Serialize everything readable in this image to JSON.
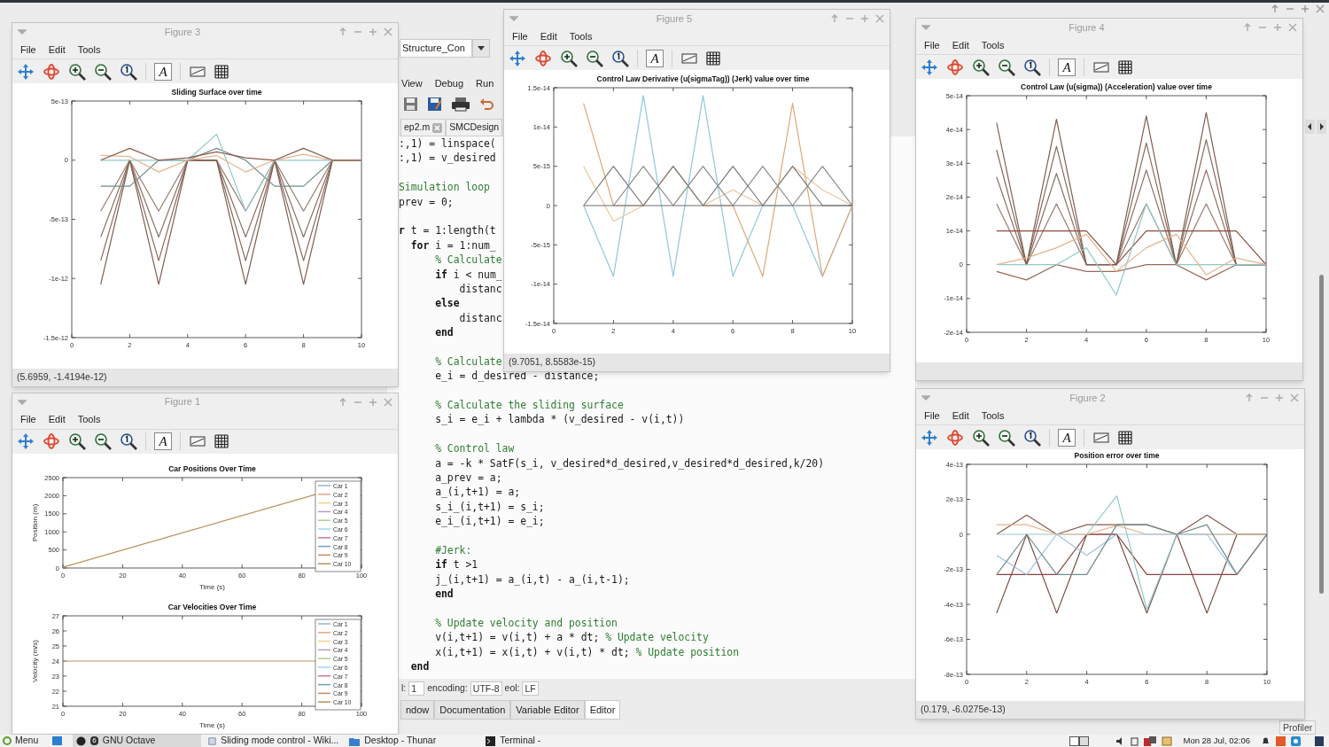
{
  "main_window": {
    "profiler_button": "Profiler"
  },
  "editor": {
    "current_directory": "Structure_Con",
    "menu": [
      "View",
      "Debug",
      "Run"
    ],
    "tabs": [
      {
        "label": "ep2.m",
        "closable": true
      },
      {
        "label": "SMCDesign",
        "closable": false
      }
    ],
    "lines": [
      {
        "kind": "code",
        "parts": [
          {
            "kind": "code",
            "text": ":,1) = linspace("
          }
        ]
      },
      {
        "kind": "code",
        "parts": [
          {
            "kind": "code",
            "text": ":,1) = v_desired"
          }
        ]
      },
      {
        "kind": "blank"
      },
      {
        "kind": "code",
        "parts": [
          {
            "kind": "comment",
            "text": "Simulation loop"
          }
        ]
      },
      {
        "kind": "code",
        "parts": [
          {
            "kind": "code",
            "text": "prev = 0;"
          }
        ]
      },
      {
        "kind": "blank"
      },
      {
        "kind": "code",
        "parts": [
          {
            "kind": "keyword",
            "text": "r"
          },
          {
            "kind": "code",
            "text": " t = 1:length(t"
          }
        ]
      },
      {
        "kind": "code",
        "parts": [
          {
            "kind": "keyword",
            "text": "  for"
          },
          {
            "kind": "code",
            "text": " i = 1:num_"
          }
        ]
      },
      {
        "kind": "code",
        "parts": [
          {
            "kind": "comment",
            "text": "      % Calculate"
          }
        ]
      },
      {
        "kind": "code",
        "parts": [
          {
            "kind": "keyword",
            "text": "      if"
          },
          {
            "kind": "code",
            "text": " i < num_"
          }
        ]
      },
      {
        "kind": "code",
        "parts": [
          {
            "kind": "code",
            "text": "          distanc"
          }
        ]
      },
      {
        "kind": "code",
        "parts": [
          {
            "kind": "keyword",
            "text": "      else"
          }
        ]
      },
      {
        "kind": "code",
        "parts": [
          {
            "kind": "code",
            "text": "          distanc"
          }
        ]
      },
      {
        "kind": "code",
        "parts": [
          {
            "kind": "keyword",
            "text": "      end"
          }
        ]
      },
      {
        "kind": "blank"
      },
      {
        "kind": "code",
        "parts": [
          {
            "kind": "comment",
            "text": "      % Calculate"
          }
        ]
      },
      {
        "kind": "code",
        "parts": [
          {
            "kind": "code",
            "text": "      e_i = d_desired - distance;"
          }
        ]
      },
      {
        "kind": "blank"
      },
      {
        "kind": "code",
        "parts": [
          {
            "kind": "comment",
            "text": "      % Calculate the sliding surface"
          }
        ]
      },
      {
        "kind": "code",
        "parts": [
          {
            "kind": "code",
            "text": "      s_i = e_i + lambda * (v_desired - v(i,t))"
          }
        ]
      },
      {
        "kind": "blank"
      },
      {
        "kind": "code",
        "parts": [
          {
            "kind": "comment",
            "text": "      % Control law"
          }
        ]
      },
      {
        "kind": "code",
        "parts": [
          {
            "kind": "code",
            "text": "      a = -k * SatF(s_i, v_desired*d_desired,v_desired*d_desired,k/20)"
          }
        ]
      },
      {
        "kind": "code",
        "parts": [
          {
            "kind": "code",
            "text": "      a_prev = a;"
          }
        ]
      },
      {
        "kind": "code",
        "parts": [
          {
            "kind": "code",
            "text": "      a_(i,t+1) = a;"
          }
        ]
      },
      {
        "kind": "code",
        "parts": [
          {
            "kind": "code",
            "text": "      s_i_(i,t+1) = s_i;"
          }
        ]
      },
      {
        "kind": "code",
        "parts": [
          {
            "kind": "code",
            "text": "      e_i_(i,t+1) = e_i;"
          }
        ]
      },
      {
        "kind": "blank"
      },
      {
        "kind": "code",
        "parts": [
          {
            "kind": "comment",
            "text": "      #Jerk:"
          }
        ]
      },
      {
        "kind": "code",
        "parts": [
          {
            "kind": "keyword",
            "text": "      if"
          },
          {
            "kind": "code",
            "text": " t >1"
          }
        ]
      },
      {
        "kind": "code",
        "parts": [
          {
            "kind": "code",
            "text": "      j_(i,t+1) = a_(i,t) - a_(i,t-1);"
          }
        ]
      },
      {
        "kind": "code",
        "parts": [
          {
            "kind": "keyword",
            "text": "      end"
          }
        ]
      },
      {
        "kind": "blank"
      },
      {
        "kind": "code",
        "parts": [
          {
            "kind": "comment",
            "text": "      % Update velocity and position"
          }
        ]
      },
      {
        "kind": "code",
        "parts": [
          {
            "kind": "code",
            "text": "      v(i,t+1) = v(i,t) + a * dt; "
          },
          {
            "kind": "comment",
            "text": "% Update velocity"
          }
        ]
      },
      {
        "kind": "code",
        "parts": [
          {
            "kind": "code",
            "text": "      x(i,t+1) = x(i,t) + v(i,t) * dt; "
          },
          {
            "kind": "comment",
            "text": "% Update position"
          }
        ]
      },
      {
        "kind": "code",
        "parts": [
          {
            "kind": "keyword",
            "text": "  end"
          }
        ]
      }
    ],
    "status": [
      {
        "kind": "label",
        "text": "l:"
      },
      {
        "kind": "field",
        "text": "1"
      },
      {
        "kind": "label",
        "text": "encoding:"
      },
      {
        "kind": "field",
        "text": "UTF-8"
      },
      {
        "kind": "label",
        "text": "eol:"
      },
      {
        "kind": "field",
        "text": "LF"
      }
    ],
    "bottom_tabs": [
      {
        "label": "ndow",
        "selected": false
      },
      {
        "label": "Documentation",
        "selected": false
      },
      {
        "label": "Variable Editor",
        "selected": false
      },
      {
        "label": "Editor",
        "selected": true
      }
    ]
  },
  "figures": [
    {
      "title": "Figure 3",
      "menu": [
        "File",
        "Edit",
        "Tools"
      ],
      "text_tool": "A",
      "status": "(5.6959, -1.4194e-12)",
      "charts": [
        {
          "chart_data": {
            "type": "line",
            "title": "Sliding Surface over time",
            "x": [
              1,
              2,
              3,
              4,
              5,
              6,
              7,
              8,
              9,
              10
            ],
            "xlim": [
              0,
              10
            ],
            "ylim": [
              -1.5e-12,
              5e-13
            ],
            "xticks": [
              0,
              2,
              4,
              6,
              8,
              10
            ],
            "yticks": [
              -1.5e-12,
              -1e-12,
              -5e-13,
              0,
              5e-13
            ],
            "series": [
              {
                "color": "#9a7c6e",
                "values": [
                  -4.3e-13,
                  0,
                  -4.3e-13,
                  0,
                  0,
                  -4.3e-13,
                  0,
                  -4.3e-13,
                  0,
                  0
                ]
              },
              {
                "color": "#8f7062",
                "values": [
                  -6.5e-13,
                  0,
                  -6.5e-13,
                  0,
                  0,
                  -6.5e-13,
                  0,
                  -6.5e-13,
                  0,
                  0
                ]
              },
              {
                "color": "#8a6a5c",
                "values": [
                  -8.5e-13,
                  0,
                  -8.5e-13,
                  0,
                  0,
                  -8.5e-13,
                  0,
                  -8.5e-13,
                  0,
                  0
                ]
              },
              {
                "color": "#7f5f52",
                "values": [
                  -1.05e-12,
                  0,
                  -1.05e-12,
                  0,
                  0,
                  -1.05e-12,
                  0,
                  -1.05e-12,
                  0,
                  0
                ]
              },
              {
                "color": "#6f8e8b",
                "values": [
                  -2.2e-13,
                  -2.2e-13,
                  0,
                  0,
                  1e-13,
                  0,
                  -2.2e-13,
                  -2.2e-13,
                  0,
                  0
                ]
              },
              {
                "color": "#8fcac4",
                "values": [
                  0,
                  0,
                  0,
                  0,
                  2.2e-13,
                  -4.3e-13,
                  0,
                  0,
                  0,
                  0
                ]
              },
              {
                "color": "#e6b48e",
                "values": [
                  4e-14,
                  3e-14,
                  -1e-13,
                  0,
                  4e-14,
                  -1e-13,
                  0,
                  5e-14,
                  0,
                  0
                ]
              },
              {
                "color": "#8b5a4e",
                "values": [
                  0,
                  1e-13,
                  0,
                  2e-14,
                  7e-14,
                  2e-14,
                  0,
                  1e-13,
                  0,
                  0
                ]
              }
            ]
          }
        }
      ]
    },
    {
      "title": "Figure 1",
      "menu": [
        "File",
        "Edit",
        "Tools"
      ],
      "text_tool": "A",
      "charts": [
        {
          "chart_data": {
            "type": "line",
            "title": "Car Positions Over Time",
            "xlabel": "Time (s)",
            "ylabel": "Position (m)",
            "legend": "lower right",
            "x": [
              0,
              100
            ],
            "xlim": [
              0,
              100
            ],
            "ylim": [
              0,
              2500
            ],
            "xticks": [
              0,
              20,
              40,
              60,
              80,
              100
            ],
            "yticks": [
              0,
              500,
              1000,
              1500,
              2000,
              2500
            ],
            "series": [
              {
                "name": "Car 1",
                "color": "#8fb7d6",
                "values": [
                  null,
                  null
                ]
              },
              {
                "name": "Car 2",
                "color": "#e8a784",
                "values": [
                  null,
                  null
                ]
              },
              {
                "name": "Car 3",
                "color": "#f0d28a",
                "values": [
                  null,
                  null
                ]
              },
              {
                "name": "Car 4",
                "color": "#b69bc0",
                "values": [
                  null,
                  null
                ]
              },
              {
                "name": "Car 5",
                "color": "#b2cf92",
                "values": [
                  null,
                  null
                ]
              },
              {
                "name": "Car 6",
                "color": "#9ad6f0",
                "values": [
                  null,
                  null
                ]
              },
              {
                "name": "Car 7",
                "color": "#c77f8f",
                "values": [
                  null,
                  null
                ]
              },
              {
                "name": "Car 8",
                "color": "#6fa0b8",
                "values": [
                  null,
                  null
                ]
              },
              {
                "name": "Car 9",
                "color": "#c98a5e",
                "values": [
                  null,
                  null
                ]
              },
              {
                "name": "Car 10",
                "color": "#b8935a",
                "values": [
                  20,
                  2400
                ]
              }
            ]
          }
        },
        {
          "chart_data": {
            "type": "line",
            "title": "Car Velocities Over Time",
            "xlabel": "Time (s)",
            "ylabel": "Velocity (m/s)",
            "legend": "lower right",
            "x": [
              0,
              100
            ],
            "xlim": [
              0,
              100
            ],
            "ylim": [
              21,
              27
            ],
            "xticks": [
              0,
              20,
              40,
              60,
              80,
              100
            ],
            "yticks": [
              21,
              22,
              23,
              24,
              25,
              26,
              27
            ],
            "series": [
              {
                "name": "Car 1",
                "color": "#8fb7d6",
                "values": [
                  null,
                  null
                ]
              },
              {
                "name": "Car 2",
                "color": "#e8a784",
                "values": [
                  null,
                  null
                ]
              },
              {
                "name": "Car 3",
                "color": "#f0d28a",
                "values": [
                  null,
                  null
                ]
              },
              {
                "name": "Car 4",
                "color": "#b69bc0",
                "values": [
                  null,
                  null
                ]
              },
              {
                "name": "Car 5",
                "color": "#b2cf92",
                "values": [
                  null,
                  null
                ]
              },
              {
                "name": "Car 6",
                "color": "#9ad6f0",
                "values": [
                  null,
                  null
                ]
              },
              {
                "name": "Car 7",
                "color": "#c77f8f",
                "values": [
                  null,
                  null
                ]
              },
              {
                "name": "Car 8",
                "color": "#6fa0b8",
                "values": [
                  null,
                  null
                ]
              },
              {
                "name": "Car 9",
                "color": "#c98a5e",
                "values": [
                  null,
                  null
                ]
              },
              {
                "name": "Car 10",
                "color": "#b8935a",
                "values": [
                  24,
                  24
                ]
              }
            ]
          }
        }
      ]
    },
    {
      "title": "Figure 5",
      "menu": [
        "File",
        "Edit",
        "Tools"
      ],
      "text_tool": "A",
      "status": "(9.7051, 8.5583e-15)",
      "charts": [
        {
          "chart_data": {
            "type": "line",
            "title": "Control Law Derivative (u(sigmaTag)) (Jerk) value over time",
            "x": [
              1,
              2,
              3,
              4,
              5,
              6,
              7,
              8,
              9,
              10
            ],
            "xlim": [
              0,
              10
            ],
            "ylim": [
              -1.5e-14,
              1.5e-14
            ],
            "xticks": [
              0,
              2,
              4,
              6,
              8,
              10
            ],
            "yticks": [
              -1.5e-14,
              -1e-14,
              -5e-15,
              0,
              5e-15,
              1e-14,
              1.5e-14
            ],
            "series": [
              {
                "color": "#8ec9d9",
                "values": [
                  0,
                  -9e-15,
                  1.4e-14,
                  -9e-15,
                  1.4e-14,
                  -9e-15,
                  0,
                  0,
                  -9e-15,
                  0
                ]
              },
              {
                "color": "#e0a878",
                "values": [
                  1.3e-14,
                  0,
                  0,
                  5e-15,
                  0,
                  0,
                  -9e-15,
                  1.3e-14,
                  -9e-15,
                  0
                ]
              },
              {
                "color": "#e8c79a",
                "values": [
                  5e-15,
                  -2e-15,
                  0,
                  null,
                  0,
                  2e-15,
                  0,
                  5e-15,
                  2e-15,
                  0
                ]
              },
              {
                "color": "#777777",
                "values": [
                  0,
                  5e-15,
                  0,
                  5e-15,
                  0,
                  5e-15,
                  0,
                  5e-15,
                  0,
                  0
                ]
              },
              {
                "color": "#8a8a8a",
                "values": [
                  null,
                  0,
                  5e-15,
                  0,
                  5e-15,
                  0,
                  5e-15,
                  0,
                  5e-15,
                  0
                ]
              },
              {
                "color": "#6e6e6e",
                "values": [
                  0,
                  0,
                  0,
                  0,
                  0,
                  0,
                  0,
                  0,
                  0,
                  0
                ]
              }
            ]
          }
        }
      ]
    },
    {
      "title": "Figure 4",
      "menu": [
        "File",
        "Edit",
        "Tools"
      ],
      "text_tool": "A",
      "charts": [
        {
          "chart_data": {
            "type": "line",
            "title": "Control Law (u(sigma)) (Acceleration) value over time",
            "x": [
              1,
              2,
              3,
              4,
              5,
              6,
              7,
              8,
              9,
              10
            ],
            "xlim": [
              0,
              10
            ],
            "ylim": [
              -2e-14,
              5e-14
            ],
            "xticks": [
              0,
              2,
              4,
              6,
              8,
              10
            ],
            "yticks": [
              -2e-14,
              -1e-14,
              0,
              1e-14,
              2e-14,
              3e-14,
              4e-14,
              5e-14
            ],
            "series": [
              {
                "color": "#9a7c6e",
                "values": [
                  1.8e-14,
                  0,
                  1.8e-14,
                  0,
                  0,
                  1.8e-14,
                  0,
                  1.8e-14,
                  0,
                  0
                ]
              },
              {
                "color": "#8f7062",
                "values": [
                  2.6e-14,
                  0,
                  2.7e-14,
                  0,
                  0,
                  2.8e-14,
                  0,
                  2.8e-14,
                  0,
                  0
                ]
              },
              {
                "color": "#8a6a5c",
                "values": [
                  3.4e-14,
                  0,
                  3.5e-14,
                  0,
                  0,
                  3.6e-14,
                  0,
                  3.7e-14,
                  0,
                  0
                ]
              },
              {
                "color": "#7f5f52",
                "values": [
                  4.2e-14,
                  0,
                  4.3e-14,
                  0,
                  0,
                  4.4e-14,
                  0,
                  4.5e-14,
                  0,
                  0
                ]
              },
              {
                "color": "#8b4a40",
                "values": [
                  1e-14,
                  1e-14,
                  1e-14,
                  1e-14,
                  0,
                  1e-14,
                  1e-14,
                  1e-14,
                  1e-14,
                  0
                ]
              },
              {
                "color": "#9b6a5a",
                "values": [
                  -2e-15,
                  -4.5e-15,
                  0,
                  -2e-15,
                  -2e-15,
                  0,
                  0,
                  -4.5e-15,
                  0,
                  0
                ]
              },
              {
                "color": "#8fcac4",
                "values": [
                  0,
                  0,
                  0,
                  5e-15,
                  -9e-15,
                  1.8e-14,
                  0,
                  0,
                  0,
                  0
                ]
              },
              {
                "color": "#e6b48e",
                "values": [
                  0,
                  2e-15,
                  5e-15,
                  9e-15,
                  -2e-15,
                  5e-15,
                  9e-15,
                  -3e-15,
                  2e-15,
                  0
                ]
              }
            ]
          }
        }
      ]
    },
    {
      "title": "Figure 2",
      "menu": [
        "File",
        "Edit",
        "Tools"
      ],
      "text_tool": "A",
      "status": "(0.179, -6.0275e-13)",
      "charts": [
        {
          "chart_data": {
            "type": "line",
            "title": "Position error over time",
            "x": [
              1,
              2,
              3,
              4,
              5,
              6,
              7,
              8,
              9,
              10
            ],
            "xlim": [
              0,
              10
            ],
            "ylim": [
              -8e-13,
              4e-13
            ],
            "xticks": [
              0,
              2,
              4,
              6,
              8,
              10
            ],
            "yticks": [
              -8e-13,
              -6e-13,
              -4e-13,
              -2e-13,
              0,
              2e-13,
              4e-13
            ],
            "series": [
              {
                "color": "#7b4b45",
                "values": [
                  -4.5e-13,
                  0,
                  -4.5e-13,
                  0,
                  0,
                  -4.5e-13,
                  0,
                  -4.5e-13,
                  0,
                  0
                ]
              },
              {
                "color": "#8b4040",
                "values": [
                  -2.3e-13,
                  -2.3e-13,
                  -2.3e-13,
                  0,
                  0,
                  -2.3e-13,
                  -2.3e-13,
                  -2.3e-13,
                  -2.3e-13,
                  0
                ]
              },
              {
                "color": "#8b5a4e",
                "values": [
                  0,
                  1.1e-13,
                  0,
                  5.5e-14,
                  5.5e-14,
                  5.5e-14,
                  0,
                  1.1e-13,
                  0,
                  0
                ]
              },
              {
                "color": "#8fcac4",
                "values": [
                  0,
                  0,
                  0,
                  0,
                  2.2e-13,
                  -4.3e-13,
                  0,
                  0,
                  0,
                  0
                ]
              },
              {
                "color": "#e6b48e",
                "values": [
                  5.5e-14,
                  5.5e-14,
                  0,
                  0,
                  5e-14,
                  0,
                  0,
                  0,
                  0,
                  0
                ]
              },
              {
                "color": "#9cc3e0",
                "values": [
                  -1.2e-13,
                  -2.3e-13,
                  0,
                  -1.2e-13,
                  0,
                  0,
                  0,
                  0,
                  -2.3e-13,
                  null
                ]
              },
              {
                "color": "#6f8e8b",
                "values": [
                  -2.3e-13,
                  0,
                  -2.3e-13,
                  -2.3e-13,
                  5.5e-14,
                  5.5e-14,
                  0,
                  5.5e-14,
                  -2.3e-13,
                  0
                ]
              }
            ]
          }
        }
      ]
    }
  ],
  "taskbar": {
    "menu": "Menu",
    "tasks": [
      {
        "label": "GNU Octave",
        "active": true,
        "count": "6"
      },
      {
        "label": "Sliding mode control - Wiki...",
        "active": false
      },
      {
        "label": "Desktop - Thunar",
        "active": false
      },
      {
        "label": "Terminal -",
        "active": false
      }
    ],
    "clock": "Mon 28 Jul, 02:06"
  }
}
